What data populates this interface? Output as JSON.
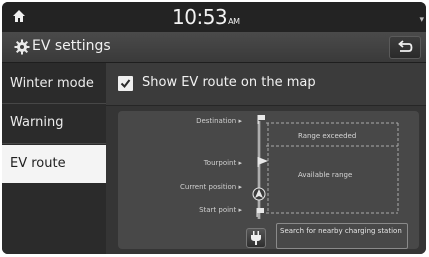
{
  "status_bar": {
    "time": "10:53",
    "ampm": "AM"
  },
  "header": {
    "title": "EV settings"
  },
  "sidebar": {
    "items": [
      {
        "label": "Winter mode"
      },
      {
        "label": "Warning"
      },
      {
        "label": "EV route"
      }
    ]
  },
  "main": {
    "show_route_label": "Show EV route on the map",
    "show_route_checked": true,
    "route_points": {
      "destination": "Destination",
      "tourpoint": "Tourpoint",
      "current_position": "Current position",
      "start_point": "Start point"
    },
    "range_exceeded": "Range exceeded",
    "available_range": "Available range",
    "search_charging": "Search for nearby charging station"
  },
  "colors": {
    "accent": "#f4f4f4",
    "background": "#2e2e2e"
  },
  "icons": [
    "home-icon",
    "gear-icon",
    "back-arrow-icon",
    "checkmark-icon",
    "flag-icon",
    "plug-icon"
  ]
}
